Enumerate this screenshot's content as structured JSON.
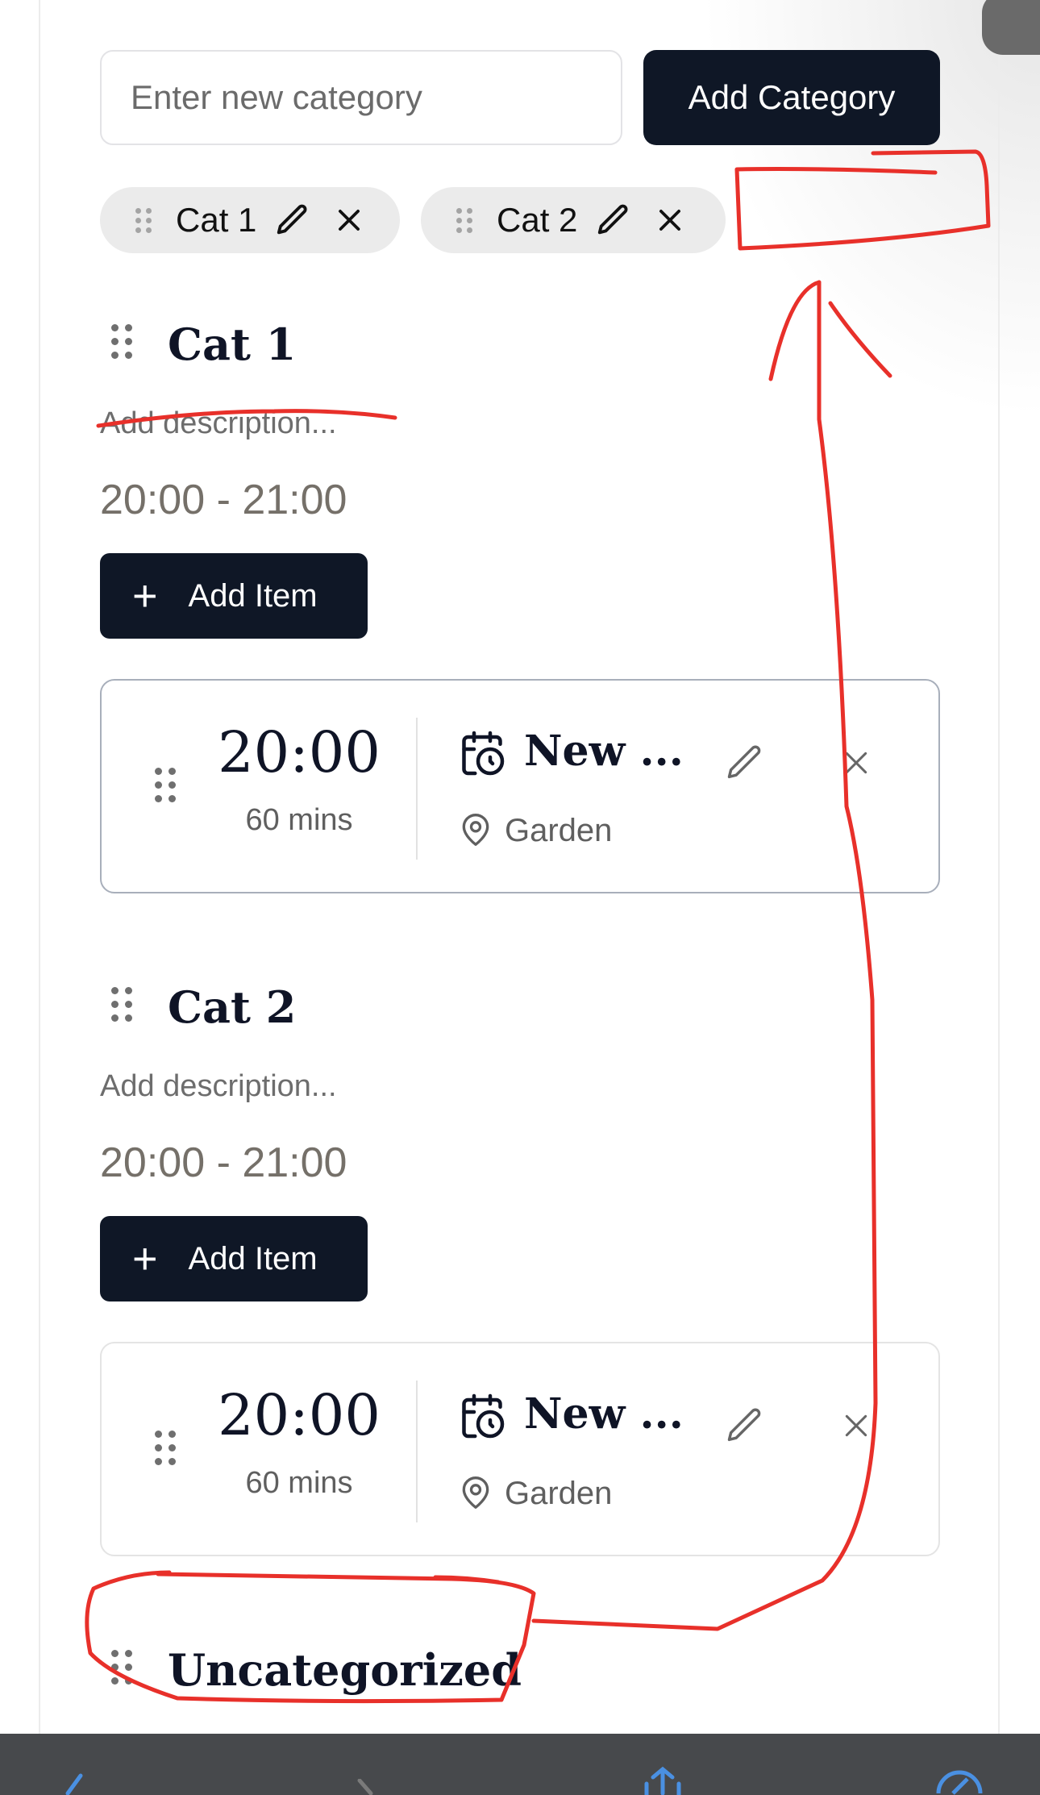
{
  "category_form": {
    "input_placeholder": "Enter new category",
    "input_value": "",
    "add_button_label": "Add Category"
  },
  "chips": [
    {
      "label": "Cat 1"
    },
    {
      "label": "Cat 2"
    }
  ],
  "categories": [
    {
      "title": "Cat 1",
      "description_placeholder": "Add description...",
      "time_range": "20:00 - 21:00",
      "add_item_label": "Add Item",
      "items": [
        {
          "time": "20:00",
          "duration": "60 mins",
          "name": "New ...",
          "location": "Garden"
        }
      ]
    },
    {
      "title": "Cat 2",
      "description_placeholder": "Add description...",
      "time_range": "20:00 - 21:00",
      "add_item_label": "Add Item",
      "items": [
        {
          "time": "20:00",
          "duration": "60 mins",
          "name": "New ...",
          "location": "Garden"
        }
      ]
    },
    {
      "title": "Uncategorized"
    }
  ],
  "icons": {
    "drag": "grip-dots-icon",
    "edit": "pencil-icon",
    "delete": "close-icon",
    "event": "calendar-clock-icon",
    "location": "map-pin-icon",
    "add": "plus-icon"
  },
  "colors": {
    "primary_button": "#0f1726",
    "chip_background": "#ebebeb",
    "annotation": "#e8302a",
    "time_range_text": "#757069"
  }
}
